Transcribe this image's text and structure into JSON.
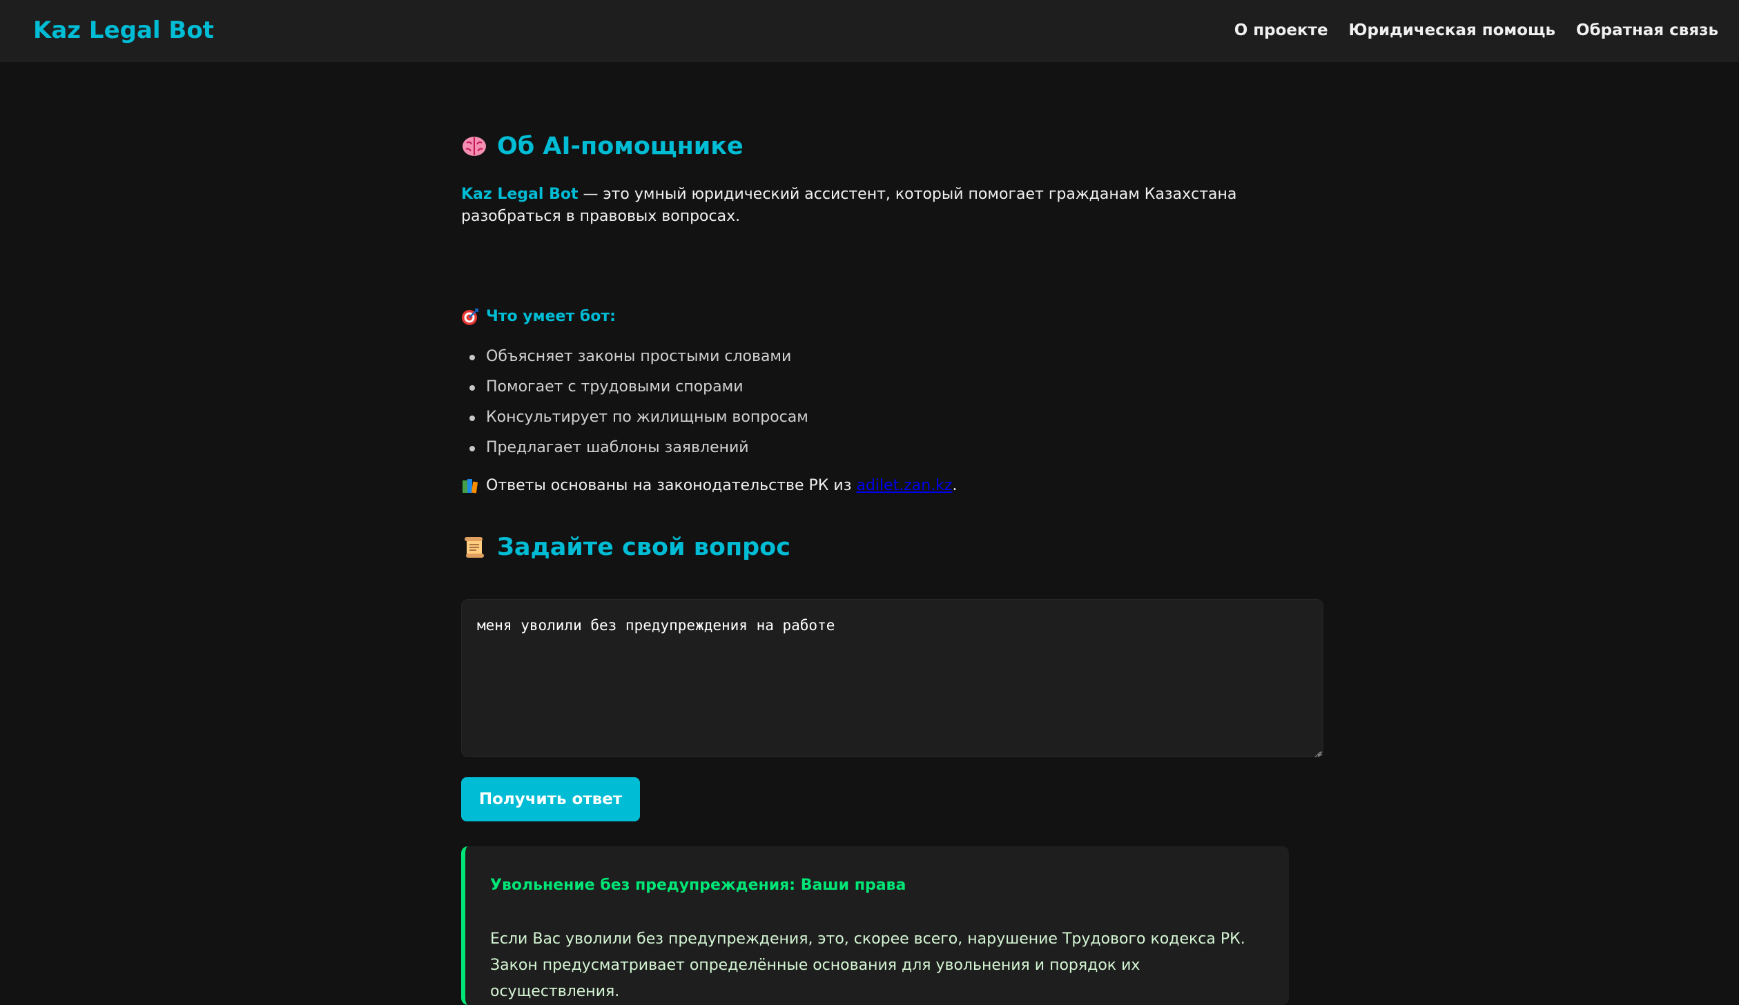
{
  "navbar": {
    "brand": "Kaz Legal Bot",
    "links": [
      "О проекте",
      "Юридическая помощь",
      "Обратная связь"
    ]
  },
  "about": {
    "icon": "brain-icon",
    "title": "Об AI-помощнике",
    "intro_highlight": "Kaz Legal Bot",
    "intro_text": " — это умный юридический ассистент, который помогает гражданам Казахстана разобраться в правовых вопросах.",
    "features_icon": "target-icon",
    "features_heading": "Что умеет бот:",
    "features": [
      "Объясняет законы простыми словами",
      "Помогает с трудовыми спорами",
      "Консультирует по жилищным вопросам",
      "Предлагает шаблоны заявлений"
    ],
    "source_icon": "books-icon",
    "source_text": "Ответы основаны на законодательстве РК из ",
    "source_link": "adilet.zan.kz",
    "source_suffix": "."
  },
  "ask": {
    "icon": "scroll-icon",
    "title": "Задайте свой вопрос",
    "question_value": "меня уволили без предупреждения на работе",
    "submit_label": "Получить ответ"
  },
  "answer": {
    "title": "Увольнение без предупреждения: Ваши права",
    "text": "Если Вас уволили без предупреждения, это, скорее всего, нарушение Трудового кодекса РК. Закон предусматривает определённые основания для увольнения и порядок их осуществления."
  },
  "colors": {
    "accent": "#00bcd4",
    "answer_accent": "#00e676",
    "background": "#121212",
    "surface": "#1e1e1e",
    "link": "#0000ee"
  }
}
